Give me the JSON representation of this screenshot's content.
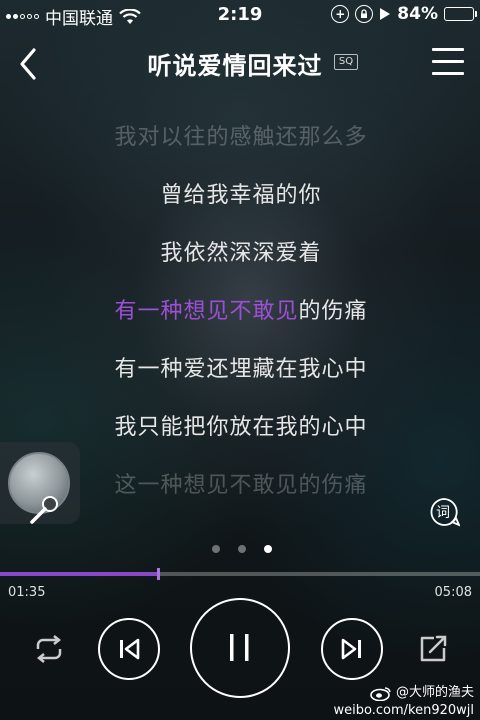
{
  "status_bar": {
    "carrier": "中国联通",
    "time": "2:19",
    "battery": "84%",
    "battery_level": 0.84
  },
  "header": {
    "title": "听说爱情回来过",
    "quality": "SQ"
  },
  "lyrics": [
    "我对以往的感触还那么多",
    "曾给我幸福的你",
    "我依然深深爱着",
    "有一种爱还埋藏在我心中",
    "我只能把你放在我的心中",
    "这一种想见不敢见的伤痛"
  ],
  "current_lyric": {
    "sung": "有一种想见不敢见",
    "unsung": "的伤痛"
  },
  "lyric_button": "词",
  "playback": {
    "elapsed": "01:35",
    "total": "05:08",
    "progress": 0.33
  },
  "pager": {
    "pages": 3,
    "active": 2
  },
  "watermark": {
    "user": "@大师的渔夫",
    "url": "weibo.com/ken920wjl"
  },
  "colors": {
    "accent": "#8a48c7",
    "sung_lyric": "#9d4fd6"
  }
}
